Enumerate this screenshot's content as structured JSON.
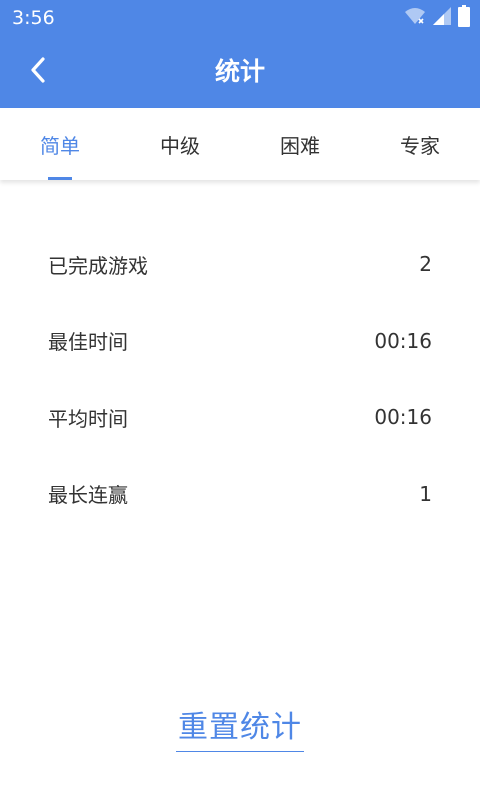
{
  "status_bar": {
    "time": "3:56",
    "icons": [
      "wifi-icon",
      "signal-icon",
      "battery-icon"
    ]
  },
  "app_bar": {
    "back_icon": "chevron-left-icon",
    "title": "统计"
  },
  "tabs": [
    {
      "label": "简单",
      "active": true
    },
    {
      "label": "中级",
      "active": false
    },
    {
      "label": "困难",
      "active": false
    },
    {
      "label": "专家",
      "active": false
    }
  ],
  "stats": [
    {
      "label": "已完成游戏",
      "value": "2"
    },
    {
      "label": "最佳时间",
      "value": "00:16"
    },
    {
      "label": "平均时间",
      "value": "00:16"
    },
    {
      "label": "最长连赢",
      "value": "1"
    }
  ],
  "reset_button": {
    "label": "重置统计"
  },
  "colors": {
    "primary": "#4f87e6",
    "text": "#333333",
    "background": "#ffffff"
  }
}
